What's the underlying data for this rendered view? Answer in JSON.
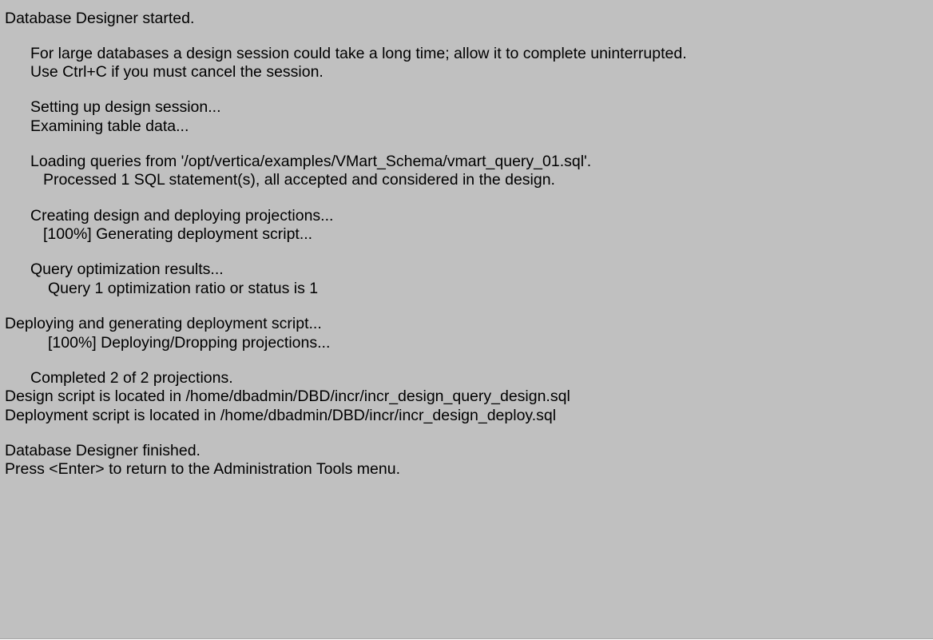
{
  "terminal": {
    "lines": {
      "started": "Database Designer started.",
      "note_large": "For large databases a design session could take a long time; allow it to complete uninterrupted.",
      "note_cancel": "Use Ctrl+C if you must cancel the session.",
      "setup": "Setting up design session...",
      "examining": "Examining table data...",
      "loading": "Loading queries from '/opt/vertica/examples/VMart_Schema/vmart_query_01.sql'.",
      "processed": "Processed 1 SQL statement(s), all accepted and considered in the design.",
      "creating": "Creating design and deploying projections...",
      "gen_script": "[100%] Generating deployment script...",
      "qopt_results": "Query optimization results...",
      "qopt_ratio": "Query 1 optimization ratio or status is 1",
      "deploying": "Deploying and generating deployment script...",
      "dropping": "[100%] Deploying/Dropping projections...",
      "completed": "Completed 2 of 2 projections.",
      "design_script": "Design script is located in /home/dbadmin/DBD/incr/incr_design_query_design.sql",
      "deploy_script": "Deployment script is located in /home/dbadmin/DBD/incr/incr_design_deploy.sql",
      "finished": "Database Designer finished.",
      "press_enter": "Press <Enter> to return to the Administration Tools menu."
    }
  },
  "colors": {
    "background": "#c0c0c0",
    "text": "#000000"
  }
}
